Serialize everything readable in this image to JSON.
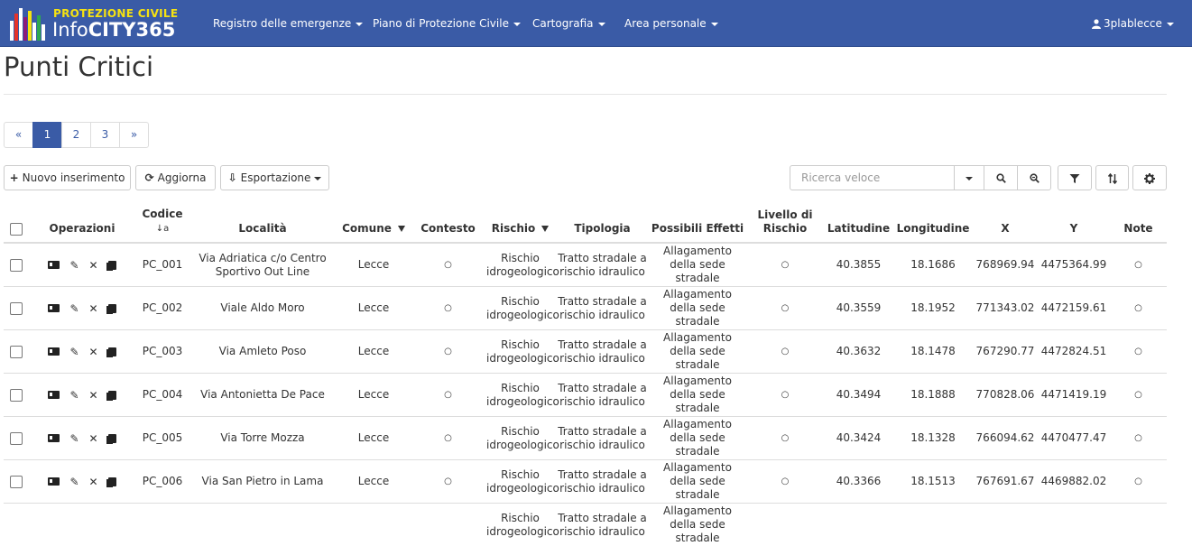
{
  "brand": {
    "line1": "PROTEZIONE CIVILE",
    "line2a": "Info",
    "line2b": "CITY365"
  },
  "nav": {
    "items": [
      "Registro delle emergenze",
      "Piano di Protezione Civile",
      "Cartografia",
      "Area personale"
    ],
    "user": "3plablecce",
    "user_icon": "user-icon"
  },
  "page_title": "Punti Critici",
  "pagination": {
    "prev": "«",
    "pages": [
      "1",
      "2",
      "3"
    ],
    "next": "»",
    "active": "1"
  },
  "toolbar": {
    "new": "Nuovo inserimento",
    "refresh": "Aggiorna",
    "export": "Esportazione",
    "search_placeholder": "Ricerca veloce"
  },
  "table": {
    "headers": {
      "operazioni": "Operazioni",
      "codice": "Codice",
      "localita": "Località",
      "comune": "Comune",
      "contesto": "Contesto",
      "rischio": "Rischio",
      "tipologia": "Tipologia",
      "effetti": "Possibili Effetti",
      "livello": "Livello di Rischio",
      "lat": "Latitudine",
      "lon": "Longitudine",
      "x": "X",
      "y": "Y",
      "note": "Note"
    },
    "rows": [
      {
        "codice": "PC_001",
        "localita": "Via Adriatica c/o Centro Sportivo Out Line",
        "comune": "Lecce",
        "contesto": "○",
        "rischio": "Rischio idrogeologico",
        "tipologia": "Tratto stradale a rischio idraulico",
        "effetti": "Allagamento della sede stradale",
        "livello": "○",
        "lat": "40.3855",
        "lon": "18.1686",
        "x": "768969.94",
        "y": "4475364.99",
        "note": "○"
      },
      {
        "codice": "PC_002",
        "localita": "Viale Aldo Moro",
        "comune": "Lecce",
        "contesto": "○",
        "rischio": "Rischio idrogeologico",
        "tipologia": "Tratto stradale a rischio idraulico",
        "effetti": "Allagamento della sede stradale",
        "livello": "○",
        "lat": "40.3559",
        "lon": "18.1952",
        "x": "771343.02",
        "y": "4472159.61",
        "note": "○"
      },
      {
        "codice": "PC_003",
        "localita": "Via Amleto Poso",
        "comune": "Lecce",
        "contesto": "○",
        "rischio": "Rischio idrogeologico",
        "tipologia": "Tratto stradale a rischio idraulico",
        "effetti": "Allagamento della sede stradale",
        "livello": "○",
        "lat": "40.3632",
        "lon": "18.1478",
        "x": "767290.77",
        "y": "4472824.51",
        "note": "○"
      },
      {
        "codice": "PC_004",
        "localita": "Via Antonietta De Pace",
        "comune": "Lecce",
        "contesto": "○",
        "rischio": "Rischio idrogeologico",
        "tipologia": "Tratto stradale a rischio idraulico",
        "effetti": "Allagamento della sede stradale",
        "livello": "○",
        "lat": "40.3494",
        "lon": "18.1888",
        "x": "770828.06",
        "y": "4471419.19",
        "note": "○"
      },
      {
        "codice": "PC_005",
        "localita": "Via Torre Mozza",
        "comune": "Lecce",
        "contesto": "○",
        "rischio": "Rischio idrogeologico",
        "tipologia": "Tratto stradale a rischio idraulico",
        "effetti": "Allagamento della sede stradale",
        "livello": "○",
        "lat": "40.3424",
        "lon": "18.1328",
        "x": "766094.62",
        "y": "4470477.47",
        "note": "○"
      },
      {
        "codice": "PC_006",
        "localita": "Via San Pietro in Lama",
        "comune": "Lecce",
        "contesto": "○",
        "rischio": "Rischio idrogeologico",
        "tipologia": "Tratto stradale a rischio idraulico",
        "effetti": "Allagamento della sede stradale",
        "livello": "○",
        "lat": "40.3366",
        "lon": "18.1513",
        "x": "767691.67",
        "y": "4469882.02",
        "note": "○"
      },
      {
        "codice": "",
        "localita": "",
        "comune": "",
        "contesto": "",
        "rischio": "Rischio idrogeologico",
        "tipologia": "Tratto stradale a rischio idraulico",
        "effetti": "Allagamento della sede stradale",
        "livello": "",
        "lat": "",
        "lon": "",
        "x": "",
        "y": "",
        "note": ""
      }
    ]
  },
  "colors": {
    "navbar": "#3a5ba6",
    "brand_yellow": "#f5e211",
    "link": "#3a5ba6"
  }
}
